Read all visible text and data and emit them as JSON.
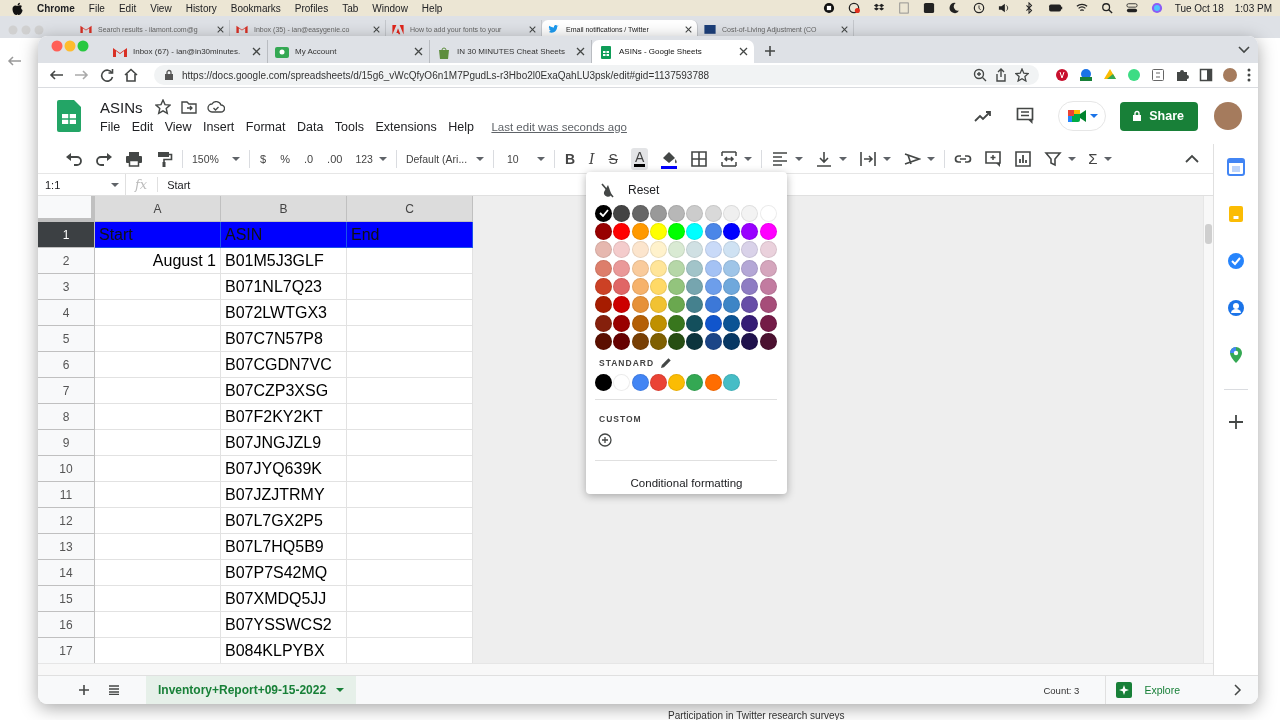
{
  "menubar": {
    "app": "Chrome",
    "menus": [
      "File",
      "Edit",
      "View",
      "History",
      "Bookmarks",
      "Profiles",
      "Tab",
      "Window",
      "Help"
    ],
    "date": "Tue Oct 18",
    "time": "1:03 PM"
  },
  "back_window": {
    "tabs": [
      {
        "title": "Search results - ilamont.com@g",
        "kind": "mail",
        "selected": false
      },
      {
        "title": "Inbox (35) - ian@easygenie.co",
        "kind": "mail",
        "selected": false
      },
      {
        "title": "How to add your fonts to your",
        "kind": "document",
        "selected": false
      },
      {
        "title": "Email notifications / Twitter",
        "kind": "bird",
        "selected": true
      },
      {
        "title": "Cost-of-Living Adjustment (CO",
        "kind": "seal",
        "selected": false
      }
    ],
    "footer_text": "Participation in Twitter research surveys"
  },
  "browser": {
    "tabs": [
      {
        "title": "Inbox (67) - ian@in30minutes.",
        "kind": "mail",
        "selected": false
      },
      {
        "title": "My Account",
        "kind": "account",
        "selected": false
      },
      {
        "title": "IN 30 MINUTES Cheat Sheets",
        "kind": "bag",
        "selected": false
      },
      {
        "title": "ASINs - Google Sheets",
        "kind": "sheets",
        "selected": true
      }
    ],
    "url": "https://docs.google.com/spreadsheets/d/15g6_vWcQfyO6n1M7PgudLs-r3Hbo2l0ExaQahLU3psk/edit#gid=1137593788"
  },
  "sheet": {
    "title": "ASINs",
    "menus": [
      "File",
      "Edit",
      "View",
      "Insert",
      "Format",
      "Data",
      "Tools",
      "Extensions",
      "Help"
    ],
    "last_edit": "Last edit was seconds ago",
    "share": "Share",
    "toolbar": {
      "zoom": "150%",
      "currency": "$",
      "percent": "%",
      "decimal_decrease": ".0",
      "decimal_increase": ".00",
      "number_format": "123",
      "font": "Default (Ari...",
      "font_size": "10",
      "bold": "B",
      "italic": "I",
      "strikethrough": "S",
      "text_color": "A",
      "text_color_open": true,
      "functions": "Σ"
    },
    "name_box": "1:1",
    "formula_label": "fx",
    "formula": "Start",
    "columns": [
      {
        "label": "A",
        "selected": true
      },
      {
        "label": "B",
        "selected": true
      },
      {
        "label": "C",
        "selected": true
      }
    ],
    "rows": [
      {
        "number": "1",
        "selected": true,
        "color": "#0000ff",
        "cells": [
          {
            "text": "Start"
          },
          {
            "text": "ASIN"
          },
          {
            "text": "End"
          }
        ]
      },
      {
        "number": "2",
        "selected": false,
        "cells": [
          {
            "text": "August 1",
            "align_right": true
          },
          {
            "text": "B01M5J3GLF"
          },
          null
        ]
      },
      {
        "number": "3",
        "selected": false,
        "cells": [
          null,
          {
            "text": "B071NL7Q23"
          },
          null
        ]
      },
      {
        "number": "4",
        "selected": false,
        "cells": [
          null,
          {
            "text": "B072LWTGX3"
          },
          null
        ]
      },
      {
        "number": "5",
        "selected": false,
        "cells": [
          null,
          {
            "text": "B07C7N57P8"
          },
          null
        ]
      },
      {
        "number": "6",
        "selected": false,
        "cells": [
          null,
          {
            "text": "B07CGDN7VC"
          },
          null
        ]
      },
      {
        "number": "7",
        "selected": false,
        "cells": [
          null,
          {
            "text": "B07CZP3XSG"
          },
          null
        ]
      },
      {
        "number": "8",
        "selected": false,
        "cells": [
          null,
          {
            "text": "B07F2KY2KT"
          },
          null
        ]
      },
      {
        "number": "9",
        "selected": false,
        "cells": [
          null,
          {
            "text": "B07JNGJZL9"
          },
          null
        ]
      },
      {
        "number": "10",
        "selected": false,
        "cells": [
          null,
          {
            "text": "B07JYQ639K"
          },
          null
        ]
      },
      {
        "number": "11",
        "selected": false,
        "cells": [
          null,
          {
            "text": "B07JZJTRMY"
          },
          null
        ]
      },
      {
        "number": "12",
        "selected": false,
        "cells": [
          null,
          {
            "text": "B07L7GX2P5"
          },
          null
        ]
      },
      {
        "number": "13",
        "selected": false,
        "cells": [
          null,
          {
            "text": "B07L7HQ5B9"
          },
          null
        ]
      },
      {
        "number": "14",
        "selected": false,
        "cells": [
          null,
          {
            "text": "B07P7S42MQ"
          },
          null
        ]
      },
      {
        "number": "15",
        "selected": false,
        "cells": [
          null,
          {
            "text": "B07XMDQ5JJ"
          },
          null
        ]
      },
      {
        "number": "16",
        "selected": false,
        "cells": [
          null,
          {
            "text": "B07YSSWCS2"
          },
          null
        ]
      },
      {
        "number": "17",
        "selected": false,
        "cells": [
          null,
          {
            "text": "B084KLPYBX"
          },
          null
        ]
      }
    ],
    "sheet_tab": "Inventory+Report+09-15-2022",
    "count": "Count: 3",
    "explore": "Explore"
  },
  "color_menu": {
    "reset": "Reset",
    "swatches": [
      {
        "color": "#000000",
        "selected": true
      },
      {
        "color": "#434343",
        "selected": false
      },
      {
        "color": "#666666",
        "selected": false
      },
      {
        "color": "#999999",
        "selected": false
      },
      {
        "color": "#b7b7b7",
        "selected": false
      },
      {
        "color": "#cccccc",
        "selected": false
      },
      {
        "color": "#d9d9d9",
        "selected": false
      },
      {
        "color": "#efefef",
        "selected": false
      },
      {
        "color": "#f3f3f3",
        "selected": false
      },
      {
        "color": "#ffffff",
        "selected": false
      },
      {
        "color": "#980000",
        "selected": false
      },
      {
        "color": "#ff0000",
        "selected": false
      },
      {
        "color": "#ff9900",
        "selected": false
      },
      {
        "color": "#ffff00",
        "selected": false
      },
      {
        "color": "#00ff00",
        "selected": false
      },
      {
        "color": "#00ffff",
        "selected": false
      },
      {
        "color": "#4a86e8",
        "selected": false
      },
      {
        "color": "#0000ff",
        "selected": false
      },
      {
        "color": "#9900ff",
        "selected": false
      },
      {
        "color": "#ff00ff",
        "selected": false
      },
      {
        "color": "#e6b8af",
        "selected": false
      },
      {
        "color": "#f4cccc",
        "selected": false
      },
      {
        "color": "#fce5cd",
        "selected": false
      },
      {
        "color": "#fff2cc",
        "selected": false
      },
      {
        "color": "#d9ead3",
        "selected": false
      },
      {
        "color": "#d0e0e3",
        "selected": false
      },
      {
        "color": "#c9daf8",
        "selected": false
      },
      {
        "color": "#cfe2f3",
        "selected": false
      },
      {
        "color": "#d9d2e9",
        "selected": false
      },
      {
        "color": "#ead1dc",
        "selected": false
      },
      {
        "color": "#dd7e6b",
        "selected": false
      },
      {
        "color": "#ea9999",
        "selected": false
      },
      {
        "color": "#f9cb9c",
        "selected": false
      },
      {
        "color": "#ffe599",
        "selected": false
      },
      {
        "color": "#b6d7a8",
        "selected": false
      },
      {
        "color": "#a2c4c9",
        "selected": false
      },
      {
        "color": "#a4c2f4",
        "selected": false
      },
      {
        "color": "#9fc5e8",
        "selected": false
      },
      {
        "color": "#b4a7d6",
        "selected": false
      },
      {
        "color": "#d5a6bd",
        "selected": false
      },
      {
        "color": "#cc4125",
        "selected": false
      },
      {
        "color": "#e06666",
        "selected": false
      },
      {
        "color": "#f6b26b",
        "selected": false
      },
      {
        "color": "#ffd966",
        "selected": false
      },
      {
        "color": "#93c47d",
        "selected": false
      },
      {
        "color": "#76a5af",
        "selected": false
      },
      {
        "color": "#6d9eeb",
        "selected": false
      },
      {
        "color": "#6fa8dc",
        "selected": false
      },
      {
        "color": "#8e7cc3",
        "selected": false
      },
      {
        "color": "#c27ba0",
        "selected": false
      },
      {
        "color": "#a61c00",
        "selected": false
      },
      {
        "color": "#cc0000",
        "selected": false
      },
      {
        "color": "#e69138",
        "selected": false
      },
      {
        "color": "#f1c232",
        "selected": false
      },
      {
        "color": "#6aa84f",
        "selected": false
      },
      {
        "color": "#45818e",
        "selected": false
      },
      {
        "color": "#3c78d8",
        "selected": false
      },
      {
        "color": "#3d85c6",
        "selected": false
      },
      {
        "color": "#674ea7",
        "selected": false
      },
      {
        "color": "#a64d79",
        "selected": false
      },
      {
        "color": "#85200c",
        "selected": false
      },
      {
        "color": "#990000",
        "selected": false
      },
      {
        "color": "#b45f06",
        "selected": false
      },
      {
        "color": "#bf9000",
        "selected": false
      },
      {
        "color": "#38761d",
        "selected": false
      },
      {
        "color": "#134f5c",
        "selected": false
      },
      {
        "color": "#1155cc",
        "selected": false
      },
      {
        "color": "#0b5394",
        "selected": false
      },
      {
        "color": "#351c75",
        "selected": false
      },
      {
        "color": "#741b47",
        "selected": false
      },
      {
        "color": "#5b0f00",
        "selected": false
      },
      {
        "color": "#660000",
        "selected": false
      },
      {
        "color": "#783f04",
        "selected": false
      },
      {
        "color": "#7f6000",
        "selected": false
      },
      {
        "color": "#274e13",
        "selected": false
      },
      {
        "color": "#0c343d",
        "selected": false
      },
      {
        "color": "#1c4587",
        "selected": false
      },
      {
        "color": "#073763",
        "selected": false
      },
      {
        "color": "#20124d",
        "selected": false
      },
      {
        "color": "#4c1130",
        "selected": false
      }
    ],
    "standard_label": "STANDARD",
    "standard": [
      {
        "color": "#000000",
        "selected": false
      },
      {
        "color": "#ffffff",
        "selected": false
      },
      {
        "color": "#4285f4",
        "selected": false
      },
      {
        "color": "#ea4335",
        "selected": false
      },
      {
        "color": "#fbbc04",
        "selected": false
      },
      {
        "color": "#34a853",
        "selected": false
      },
      {
        "color": "#ff6d01",
        "selected": false
      },
      {
        "color": "#46bdc6",
        "selected": false
      }
    ],
    "custom_label": "CUSTOM",
    "conditional": "Conditional formatting"
  }
}
